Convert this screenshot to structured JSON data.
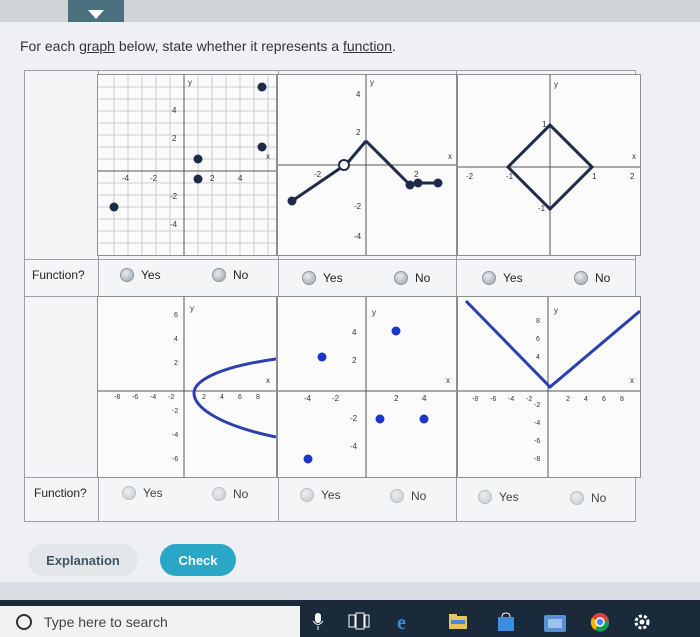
{
  "question": {
    "prefix": "For each ",
    "link1": "graph",
    "middle": " below, state whether it represents a ",
    "link2": "function",
    "suffix": "."
  },
  "rows": [
    {
      "label": "Function?",
      "options": [
        {
          "yes": "Yes",
          "no": "No"
        },
        {
          "yes": "Yes",
          "no": "No"
        },
        {
          "yes": "Yes",
          "no": "No"
        }
      ]
    },
    {
      "label": "Function?",
      "options": [
        {
          "yes": "Yes",
          "no": "No"
        },
        {
          "yes": "Yes",
          "no": "No"
        },
        {
          "yes": "Yes",
          "no": "No"
        }
      ]
    }
  ],
  "graphs": {
    "g1": {
      "ylabels": [
        "4",
        "2",
        "-2",
        "-4"
      ],
      "xlabels": [
        "-4",
        "-2",
        "2",
        "4"
      ],
      "axis_x": "x",
      "axis_y": "y"
    },
    "g2": {
      "ylabels": [
        "4",
        "2",
        "-2",
        "-4"
      ],
      "xlabels": [
        "-2",
        "2"
      ],
      "axis_x": "x",
      "axis_y": "y"
    },
    "g3": {
      "ylabels": [
        "1",
        "-1"
      ],
      "xlabels": [
        "-2",
        "-1",
        "1",
        "2"
      ],
      "axis_x": "x",
      "axis_y": "y"
    },
    "g4": {
      "ylabels": [
        "6",
        "4",
        "2",
        "-2",
        "-4",
        "-6"
      ],
      "xlabels": [
        "-8",
        "-6",
        "-4",
        "-2",
        "2",
        "4",
        "6",
        "8"
      ],
      "axis_x": "x",
      "axis_y": "y"
    },
    "g5": {
      "ylabels": [
        "4",
        "2",
        "-2",
        "-4"
      ],
      "xlabels": [
        "-4",
        "-2",
        "2",
        "4"
      ],
      "axis_x": "x",
      "axis_y": "y"
    },
    "g6": {
      "ylabels": [
        "8",
        "6",
        "4",
        "-2",
        "-4",
        "-6",
        "-8"
      ],
      "xlabels": [
        "-8",
        "-6",
        "-4",
        "-2",
        "2",
        "4",
        "6",
        "8"
      ],
      "axis_x": "x",
      "axis_y": "y"
    }
  },
  "buttons": {
    "explanation": "Explanation",
    "check": "Check"
  },
  "taskbar": {
    "search_placeholder": "Type here to search"
  },
  "colors": {
    "accent": "#2aa6c6",
    "plot_blue": "#2b3fb0",
    "dot_dark": "#1e2a4a"
  }
}
